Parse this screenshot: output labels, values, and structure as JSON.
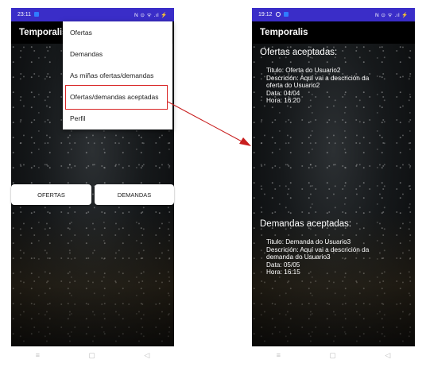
{
  "left_screen": {
    "status_time": "23:11",
    "status_icons": "N ⊙ ᯤ .ıl ⚡",
    "app_title": "Temporalis",
    "menu_items": [
      "Ofertas",
      "Demandas",
      "As miñas ofertas/demandas",
      "Ofertas/demandas aceptadas",
      "Perfil"
    ],
    "buttons": {
      "ofertas": "OFERTAS",
      "demandas": "DEMANDAS"
    },
    "nav": {
      "menu": "≡",
      "home": "▢",
      "back": "◁"
    }
  },
  "right_screen": {
    "status_time": "19:12",
    "status_icons": "N ⊙ ᯤ .ıl ⚡",
    "app_title": "Temporalis",
    "ofertas_title": "Ofertas aceptadas:",
    "oferta": {
      "titulo": "Titulo: Oferta do Usuario2",
      "descricion_1": "Descrición: Aquí vai a descrición da",
      "descricion_2": "oferta do Usuario2",
      "data": "Data: 04/04",
      "hora": "Hora: 16:20"
    },
    "demandas_title": "Demandas aceptadas:",
    "demanda": {
      "titulo": "Titulo: Demanda do Usuario3",
      "descricion_1": "Descrición: Aquí vai a descrición da",
      "descricion_2": "demanda do Usuario3",
      "data": "Data: 05/05",
      "hora": "Hora: 16:15"
    },
    "nav": {
      "menu": "≡",
      "home": "▢",
      "back": "◁"
    }
  },
  "colors": {
    "status_bar": "#3a2dc8",
    "app_bar": "#000000",
    "highlight": "#d92626",
    "arrow": "#c81e1e"
  }
}
